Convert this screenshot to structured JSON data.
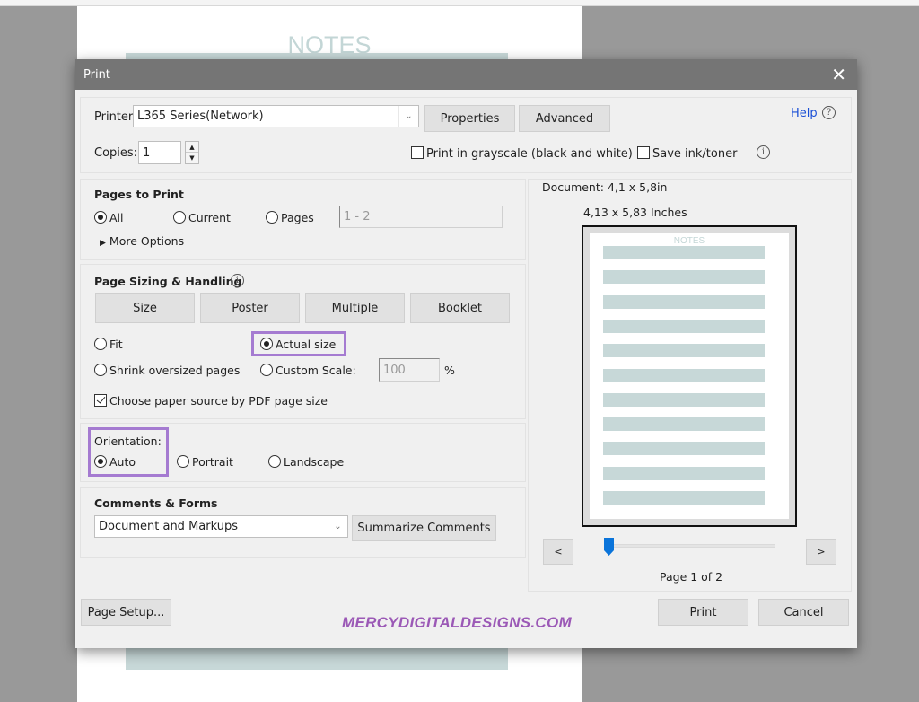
{
  "background": {
    "page_title": "NOTES"
  },
  "dialog": {
    "title": "Print",
    "close_icon": "close-icon"
  },
  "printer": {
    "label": "Printer:",
    "value": "L365 Series(Network)",
    "properties_button": "Properties",
    "advanced_button": "Advanced",
    "help_link": "Help",
    "copies_label": "Copies:",
    "copies_value": "1",
    "grayscale_label": "Print in grayscale (black and white)",
    "grayscale_checked": false,
    "save_ink_label": "Save ink/toner",
    "save_ink_checked": false
  },
  "pages_to_print": {
    "heading": "Pages to Print",
    "options": [
      "All",
      "Current",
      "Pages"
    ],
    "selected": "All",
    "pages_range_value": "1 - 2",
    "more_options": "More Options"
  },
  "page_sizing": {
    "heading": "Page Sizing & Handling",
    "tabs": [
      "Size",
      "Poster",
      "Multiple",
      "Booklet"
    ],
    "fit_label": "Fit",
    "actual_size_label": "Actual size",
    "shrink_label": "Shrink oversized pages",
    "custom_scale_label": "Custom Scale:",
    "custom_scale_value": "100",
    "percent_sign": "%",
    "selected": "Actual size",
    "paper_source_label": "Choose paper source by PDF page size",
    "paper_source_checked": true
  },
  "orientation": {
    "label": "Orientation:",
    "options": [
      "Auto",
      "Portrait",
      "Landscape"
    ],
    "selected": "Auto"
  },
  "comments_forms": {
    "heading": "Comments & Forms",
    "value": "Document and Markups",
    "summarize_button": "Summarize Comments"
  },
  "preview": {
    "document_size": "Document: 4,1 x 5,8in",
    "paper_size": "4,13 x 5,83 Inches",
    "sheet_title": "NOTES",
    "prev_button": "<",
    "next_button": ">",
    "page_status": "Page 1 of 2",
    "current_page": 1,
    "total_pages": 2
  },
  "footer": {
    "page_setup_button": "Page Setup...",
    "print_button": "Print",
    "cancel_button": "Cancel",
    "watermark": "MERCYDIGITALDESIGNS.COM"
  },
  "colors": {
    "highlight": "#a57bd1",
    "watermark": "#9b59b6",
    "slider_thumb": "#0a74da",
    "notes_lines": "#c7d8d8"
  }
}
